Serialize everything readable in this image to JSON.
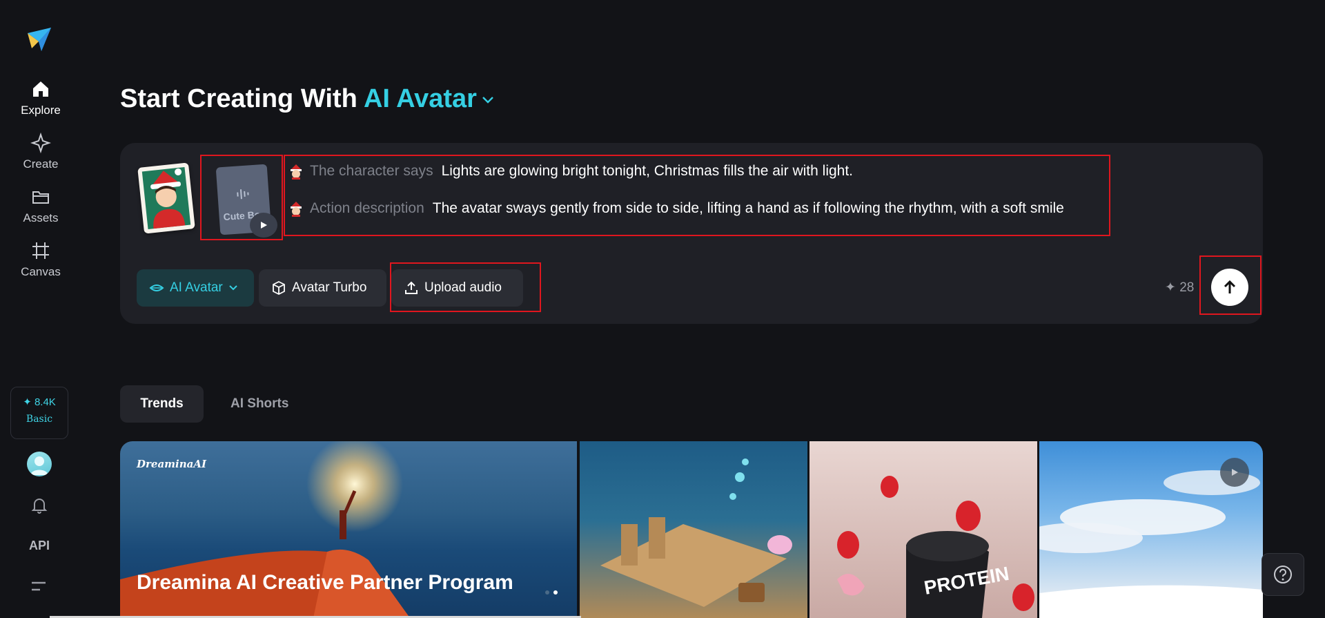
{
  "sidebar": {
    "items": [
      {
        "label": "Explore",
        "icon": "home-icon"
      },
      {
        "label": "Create",
        "icon": "sparkle-icon"
      },
      {
        "label": "Assets",
        "icon": "folder-icon"
      },
      {
        "label": "Canvas",
        "icon": "canvas-icon"
      }
    ],
    "credits": {
      "amount": "✦ 8.4K",
      "tier": "Basic"
    },
    "api_label": "API"
  },
  "heading": {
    "prefix": "Start Creating With ",
    "accent": "AI Avatar"
  },
  "prompt": {
    "audio_name": "Cute Bo",
    "character_says_label": "The character says",
    "character_says_value": "Lights are glowing bright tonight, Christmas fills the air with light.",
    "action_label": "Action description",
    "action_value": "The avatar sways gently from side to side, lifting a hand as if following the rhythm, with a soft smile"
  },
  "toolbar": {
    "mode_label": "AI Avatar",
    "model_label": "Avatar Turbo",
    "upload_label": "Upload audio",
    "cost": "✦ 28"
  },
  "tabs": [
    {
      "label": "Trends",
      "active": true
    },
    {
      "label": "AI Shorts",
      "active": false
    }
  ],
  "gallery": {
    "banner_title": "Dreamina AI Creative Partner Program",
    "brand": "DreaminaAI",
    "tiles": [
      "ocean-ruins-tile",
      "protein-tile",
      "sky-tile"
    ]
  },
  "colors": {
    "accent": "#35cfe3",
    "highlight": "#e0161e",
    "background": "#121317",
    "card": "#1f2026"
  }
}
